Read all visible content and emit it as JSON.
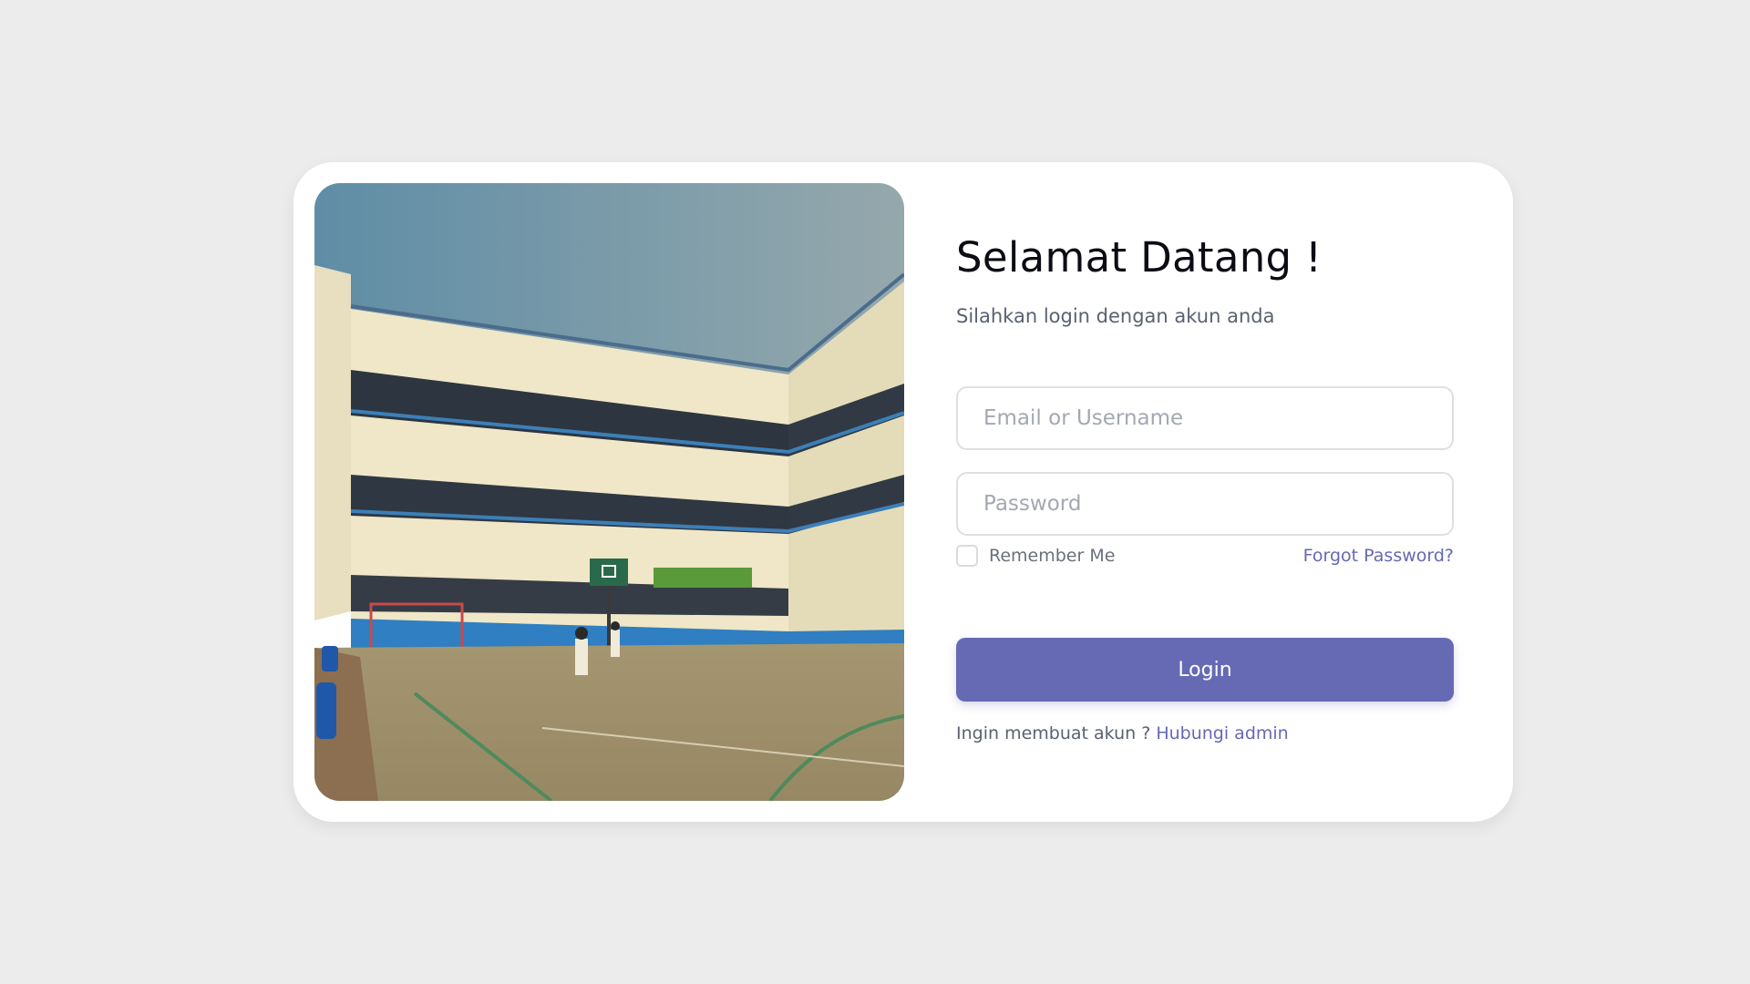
{
  "colors": {
    "background": "#ececec",
    "card": "#ffffff",
    "accent": "#6669b4",
    "link": "#6568b3"
  },
  "login": {
    "title": "Selamat Datang !",
    "subtitle": "Silahkan login dengan akun anda",
    "email_placeholder": "Email or Username",
    "email_value": "",
    "password_placeholder": "Password",
    "password_value": "",
    "remember_label": "Remember Me",
    "remember_checked": false,
    "forgot_label": "Forgot Password?",
    "login_label": "Login",
    "signup_prompt": "Ingin membuat akun ?",
    "signup_link": "Hubungi admin"
  }
}
